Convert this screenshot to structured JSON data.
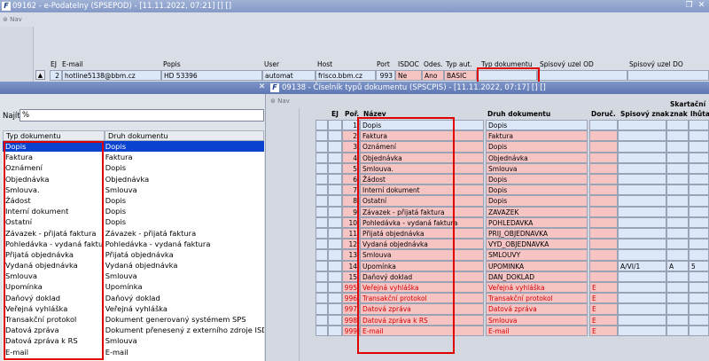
{
  "back_window": {
    "title": "09162 - e-Podatelny (SPSEPOD) - [11.11.2022, 07:21] [] []",
    "nav_label": "Nav",
    "columns": [
      "EJ",
      "E-mail",
      "Popis",
      "User",
      "Host",
      "Port",
      "ISDOC",
      "Odes.",
      "Typ aut.",
      "Typ dokumentu",
      "Spisový uzel OD",
      "Spisový uzel DO"
    ],
    "row": {
      "ej": "2",
      "email": "hotline5138@bbm.cz",
      "popis": "HD 53396",
      "user": "automat",
      "host": "frisco.bbm.cz",
      "port": "993",
      "isdoc": "Ne",
      "odes": "Ano",
      "typ_aut": "BASIC",
      "typ_dokumentu": "",
      "uzel_od": "",
      "uzel_do": ""
    }
  },
  "front_window": {
    "title": "09138 - Číselník typů dokumentu (SPSCPIS) - [11.11.2022, 07:17] [] []",
    "nav_label": "Nav",
    "columns": {
      "ej": "EJ",
      "por": "Poř.",
      "nazev": "Název",
      "druh": "Druh dokumentu",
      "doruc": "Doruč.",
      "znak": "Spisový znak",
      "skart_top": "Skartační",
      "skart_znak": "znak",
      "skart_lhuta": "lhůta"
    },
    "rows": [
      {
        "por": "1",
        "nazev": "Dopis",
        "druh": "Dopis",
        "doruc": "",
        "znak": "",
        "skart_znak": "",
        "lhuta": ""
      },
      {
        "por": "2",
        "nazev": "Faktura",
        "druh": "Faktura",
        "doruc": "",
        "znak": "",
        "skart_znak": "",
        "lhuta": ""
      },
      {
        "por": "3",
        "nazev": "Oznámení",
        "druh": "Dopis",
        "doruc": "",
        "znak": "",
        "skart_znak": "",
        "lhuta": ""
      },
      {
        "por": "4",
        "nazev": "Objednávka",
        "druh": "Objednávka",
        "doruc": "",
        "znak": "",
        "skart_znak": "",
        "lhuta": ""
      },
      {
        "por": "5",
        "nazev": "Smlouva.",
        "druh": "Smlouva",
        "doruc": "",
        "znak": "",
        "skart_znak": "",
        "lhuta": ""
      },
      {
        "por": "6",
        "nazev": "Žádost",
        "druh": "Dopis",
        "doruc": "",
        "znak": "",
        "skart_znak": "",
        "lhuta": ""
      },
      {
        "por": "7",
        "nazev": "Interní dokument",
        "druh": "Dopis",
        "doruc": "",
        "znak": "",
        "skart_znak": "",
        "lhuta": ""
      },
      {
        "por": "8",
        "nazev": "Ostatní",
        "druh": "Dopis",
        "doruc": "",
        "znak": "",
        "skart_znak": "",
        "lhuta": ""
      },
      {
        "por": "9",
        "nazev": "Závazek - přijatá faktura",
        "druh": "ZAVAZEK",
        "doruc": "",
        "znak": "",
        "skart_znak": "",
        "lhuta": ""
      },
      {
        "por": "10",
        "nazev": "Pohledávka - vydaná faktura",
        "druh": "POHLEDAVKA",
        "doruc": "",
        "znak": "",
        "skart_znak": "",
        "lhuta": ""
      },
      {
        "por": "11",
        "nazev": "Přijatá objednávka",
        "druh": "PRIJ_OBJEDNAVKA",
        "doruc": "",
        "znak": "",
        "skart_znak": "",
        "lhuta": ""
      },
      {
        "por": "12",
        "nazev": "Vydaná objednávka",
        "druh": "VYD_OBJEDNAVKA",
        "doruc": "",
        "znak": "",
        "skart_znak": "",
        "lhuta": ""
      },
      {
        "por": "13",
        "nazev": "Smlouva",
        "druh": "SMLOUVY",
        "doruc": "",
        "znak": "",
        "skart_znak": "",
        "lhuta": ""
      },
      {
        "por": "14",
        "nazev": "Upomínka",
        "druh": "UPOMINKA",
        "doruc": "",
        "znak": "A/VI/1",
        "skart_znak": "A",
        "lhuta": "5"
      },
      {
        "por": "15",
        "nazev": "Daňový doklad",
        "druh": "DAN_DOKLAD",
        "doruc": "",
        "znak": "",
        "skart_znak": "",
        "lhuta": ""
      },
      {
        "por": "995",
        "nazev": "Veřejná vyhláška",
        "druh": "Veřejná vyhláška",
        "doruc": "E",
        "znak": "",
        "skart_znak": "",
        "lhuta": ""
      },
      {
        "por": "996",
        "nazev": "Transakční protokol",
        "druh": "Transakční protokol",
        "doruc": "E",
        "znak": "",
        "skart_znak": "",
        "lhuta": ""
      },
      {
        "por": "997",
        "nazev": "Datová zpráva",
        "druh": "Datová zpráva",
        "doruc": "E",
        "znak": "",
        "skart_znak": "",
        "lhuta": ""
      },
      {
        "por": "998",
        "nazev": "Datová zpráva k RS",
        "druh": "Smlouva",
        "doruc": "E",
        "znak": "",
        "skart_znak": "",
        "lhuta": ""
      },
      {
        "por": "999",
        "nazev": "E-mail",
        "druh": "E-mail",
        "doruc": "E",
        "znak": "",
        "skart_znak": "",
        "lhuta": ""
      }
    ]
  },
  "lov": {
    "search_label": "Najít",
    "search_value": "%",
    "col1": "Typ dokumentu",
    "col2": "Druh dokumentu",
    "items": [
      {
        "typ": "Dopis",
        "druh": "Dopis"
      },
      {
        "typ": "Faktura",
        "druh": "Faktura"
      },
      {
        "typ": "Oznámení",
        "druh": "Dopis"
      },
      {
        "typ": "Objednávka",
        "druh": "Objednávka"
      },
      {
        "typ": "Smlouva.",
        "druh": "Smlouva"
      },
      {
        "typ": "Žádost",
        "druh": "Dopis"
      },
      {
        "typ": "Interní dokument",
        "druh": "Dopis"
      },
      {
        "typ": "Ostatní",
        "druh": "Dopis"
      },
      {
        "typ": "Závazek - přijatá faktura",
        "druh": "Závazek - přijatá faktura"
      },
      {
        "typ": "Pohledávka - vydaná faktura",
        "druh": "Pohledávka - vydaná faktura"
      },
      {
        "typ": "Přijatá objednávka",
        "druh": "Přijatá objednávka"
      },
      {
        "typ": "Vydaná objednávka",
        "druh": "Vydaná objednávka"
      },
      {
        "typ": "Smlouva",
        "druh": "Smlouva"
      },
      {
        "typ": "Upomínka",
        "druh": "Upomínka"
      },
      {
        "typ": "Daňový doklad",
        "druh": "Daňový doklad"
      },
      {
        "typ": "Veřejná vyhláška",
        "druh": "Veřejná vyhláška"
      },
      {
        "typ": "Transakční protokol",
        "druh": "Dokument generovaný systémem SPS"
      },
      {
        "typ": "Datová zpráva",
        "druh": "Dokument přenesený z externího zdroje ISDS"
      },
      {
        "typ": "Datová zpráva k RS",
        "druh": "Smlouva"
      },
      {
        "typ": "E-mail",
        "druh": "E-mail"
      }
    ]
  },
  "colors": {
    "highlight_red": "#e00000",
    "selection_blue": "#0a42d0",
    "row_pink": "#f7c4c4",
    "row_blue": "#dce8f8",
    "title_blue": "#5d77b4"
  }
}
